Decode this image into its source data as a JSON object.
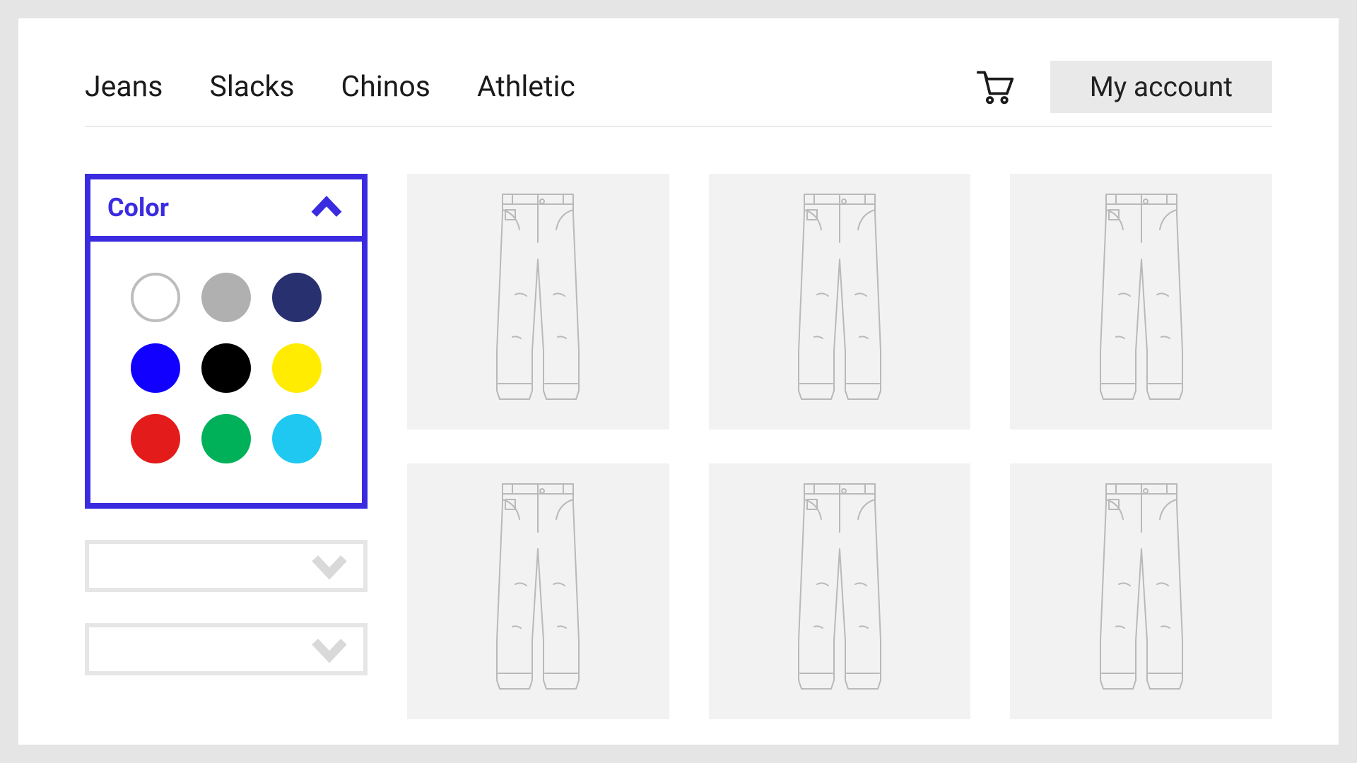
{
  "nav": {
    "items": [
      "Jeans",
      "Slacks",
      "Chinos",
      "Athletic"
    ]
  },
  "header": {
    "my_account_label": "My account"
  },
  "filters": {
    "color": {
      "title": "Color",
      "swatches": [
        {
          "name": "white",
          "hex": "#ffffff",
          "outline": true
        },
        {
          "name": "gray",
          "hex": "#b0b0b0",
          "outline": false
        },
        {
          "name": "navy",
          "hex": "#28306f",
          "outline": false
        },
        {
          "name": "blue",
          "hex": "#1200ff",
          "outline": false
        },
        {
          "name": "black",
          "hex": "#000000",
          "outline": false
        },
        {
          "name": "yellow",
          "hex": "#ffec00",
          "outline": false
        },
        {
          "name": "red",
          "hex": "#e31b1b",
          "outline": false
        },
        {
          "name": "green",
          "hex": "#00b15a",
          "outline": false
        },
        {
          "name": "sky-blue",
          "hex": "#1fc8f0",
          "outline": false
        }
      ]
    },
    "collapsed_count": 2
  },
  "products": {
    "count": 6
  },
  "colors": {
    "accent": "#3a2be0",
    "panel_bg": "#f2f2f2",
    "outline": "#bdbdbd"
  }
}
